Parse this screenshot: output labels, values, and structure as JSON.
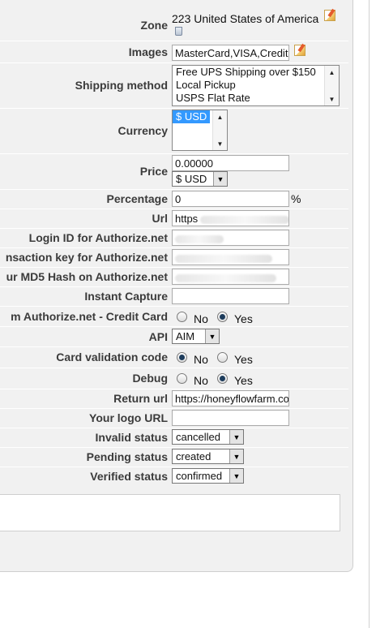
{
  "form": {
    "zone": {
      "label": "Zone",
      "value": "223 United States of America"
    },
    "images": {
      "label": "Images",
      "value": "MasterCard,VISA,Credit"
    },
    "shipping_method": {
      "label": "Shipping method",
      "options": [
        "Free UPS Shipping over $150",
        "Local Pickup",
        "USPS Flat Rate"
      ]
    },
    "currency": {
      "label": "Currency",
      "options": [
        "$ USD"
      ]
    },
    "price": {
      "label": "Price",
      "value": "0.00000",
      "currency": "$ USD"
    },
    "percentage": {
      "label": "Percentage",
      "value": "0",
      "suffix": "%"
    },
    "url": {
      "label": "Url",
      "value": "https"
    },
    "login_id": {
      "label": "Login ID for Authorize.net"
    },
    "transaction_key": {
      "label": "nsaction key for Authorize.net"
    },
    "md5_hash": {
      "label": "ur MD5 Hash on Authorize.net"
    },
    "instant_capture": {
      "label": "Instant Capture",
      "value": ""
    },
    "credit_card": {
      "label": "m Authorize.net - Credit Card",
      "no": "No",
      "yes": "Yes"
    },
    "api": {
      "label": "API",
      "value": "AIM"
    },
    "card_validation": {
      "label": "Card validation code",
      "no": "No",
      "yes": "Yes"
    },
    "debug": {
      "label": "Debug",
      "no": "No",
      "yes": "Yes"
    },
    "return_url": {
      "label": "Return url",
      "value": "https://honeyflowfarm.co"
    },
    "logo_url": {
      "label": "Your logo URL",
      "value": ""
    },
    "invalid_status": {
      "label": "Invalid status",
      "value": "cancelled"
    },
    "pending_status": {
      "label": "Pending status",
      "value": "created"
    },
    "verified_status": {
      "label": "Verified status",
      "value": "confirmed"
    }
  }
}
